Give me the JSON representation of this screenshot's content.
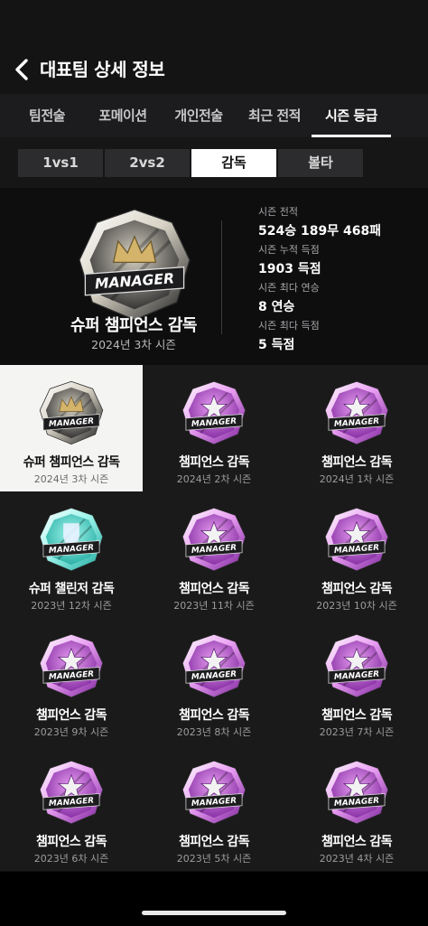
{
  "header": {
    "title": "대표팀 상세 정보"
  },
  "tabs": [
    {
      "label": "팀전술"
    },
    {
      "label": "포메이션"
    },
    {
      "label": "개인전술"
    },
    {
      "label": "최근 전적"
    },
    {
      "label": "시즌 등급",
      "active": true
    }
  ],
  "segments": [
    {
      "label": "1vs1"
    },
    {
      "label": "2vs2"
    },
    {
      "label": "감독",
      "active": true
    },
    {
      "label": "볼타"
    }
  ],
  "summary": {
    "badge": {
      "text": "MANAGER",
      "type": "super-champions",
      "icon": "crown-icon"
    },
    "name": "슈퍼 챔피언스 감독",
    "season": "2024년 3차 시즌",
    "stats": [
      {
        "label": "시즌 전적",
        "value": "524승 189무 468패"
      },
      {
        "label": "시즌 누적 득점",
        "value": "1903 득점"
      },
      {
        "label": "시즌 최다 연승",
        "value": "8 연승"
      },
      {
        "label": "시즌 최다 득점",
        "value": "5 득점"
      }
    ]
  },
  "badge_text": "MANAGER",
  "grades": [
    {
      "name": "슈퍼 챔피언스 감독",
      "season": "2024년 3차 시즌",
      "type": "super-champions",
      "selected": true
    },
    {
      "name": "챔피언스 감독",
      "season": "2024년 2차 시즌",
      "type": "champions"
    },
    {
      "name": "챔피언스 감독",
      "season": "2024년 1차 시즌",
      "type": "champions"
    },
    {
      "name": "슈퍼 챌린저 감독",
      "season": "2023년 12차 시즌",
      "type": "super-challenger"
    },
    {
      "name": "챔피언스 감독",
      "season": "2023년 11차 시즌",
      "type": "champions"
    },
    {
      "name": "챔피언스 감독",
      "season": "2023년 10차 시즌",
      "type": "champions"
    },
    {
      "name": "챔피언스 감독",
      "season": "2023년 9차 시즌",
      "type": "champions"
    },
    {
      "name": "챔피언스 감독",
      "season": "2023년 8차 시즌",
      "type": "champions"
    },
    {
      "name": "챔피언스 감독",
      "season": "2023년 7차 시즌",
      "type": "champions"
    },
    {
      "name": "챔피언스 감독",
      "season": "2023년 6차 시즌",
      "type": "champions"
    },
    {
      "name": "챔피언스 감독",
      "season": "2023년 5차 시즌",
      "type": "champions"
    },
    {
      "name": "챔피언스 감독",
      "season": "2023년 4차 시즌",
      "type": "champions"
    }
  ],
  "colors": {
    "super-champions": {
      "outer": "#d7d2c4",
      "inner": "#1b1b1d",
      "accent": "#d4b36a"
    },
    "champions": {
      "outer": "#e9a0f2",
      "inner": "#7a1f9a",
      "accent": "#f2f2f2"
    },
    "super-challenger": {
      "outer": "#9ff5ec",
      "inner": "#1aa69c",
      "accent": "#e8f2ff"
    }
  }
}
